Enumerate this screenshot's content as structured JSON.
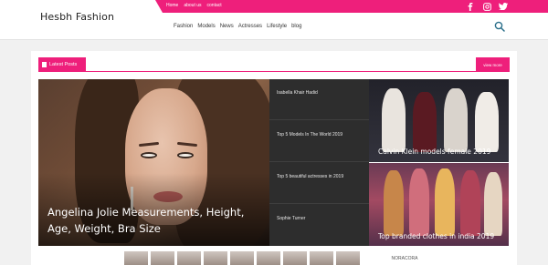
{
  "site": {
    "logo_text": "Hesbh Fashion"
  },
  "topbar": {
    "links": [
      "Home",
      "about us",
      "contact"
    ],
    "social_icons": [
      "facebook-icon",
      "instagram-icon",
      "twitter-icon"
    ],
    "accent": "#ee1f7b"
  },
  "nav": {
    "items": [
      "Fashion",
      "Models",
      "News",
      "Actresses",
      "Lifestyle",
      "blog"
    ]
  },
  "section": {
    "title": "Latest Posts",
    "view_more": "view more"
  },
  "featured": {
    "title": "Angelina Jolie Measurements, Height, Age, Weight, Bra Size"
  },
  "list": {
    "items": [
      "Isabella Khair Hadid",
      "Top 5 Models In The World 2019",
      "Top 5 beautiful actresses in 2019",
      "Sophie Turner"
    ]
  },
  "tiles": [
    {
      "title": "Calvin Klein models female 2019"
    },
    {
      "title": "Top branded clothes in india 2019"
    }
  ],
  "ad": {
    "brand": "NORACORA"
  }
}
